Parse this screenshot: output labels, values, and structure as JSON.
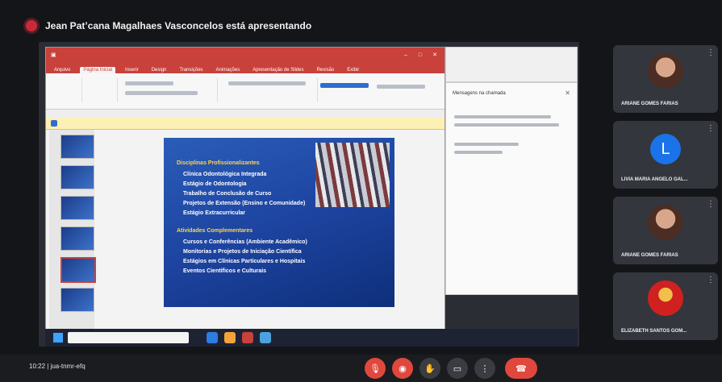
{
  "meeting": {
    "presenter_banner": "Jean Pat’cana Magalhaes Vasconcelos está apresentando",
    "clock": "10:22 | jua-tnmr-efq"
  },
  "ppt": {
    "window_title": "",
    "tabs": [
      "Arquivo",
      "Página Inicial",
      "Inserir",
      "Design",
      "Transições",
      "Animações",
      "Apresentação de Slides",
      "Revisão",
      "Exibir"
    ],
    "active_tab_index": 1
  },
  "slide": {
    "lines": [
      "Disciplinas Profissionalizantes",
      "Clínica Odontológica Integrada",
      "Estágio de Odontologia",
      "Trabalho de Conclusão de Curso",
      "Projetos de Extensão (Ensino e Comunidade)",
      "Estágio Extracurricular",
      "",
      "Atividades Complementares",
      "Cursos e Conferências (Ambiente Acadêmico)",
      "Monitorias e Projetos de Iniciação Científica",
      "Estágios em Clínicas Particulares e Hospitais",
      "Eventos Científicos e Culturais"
    ]
  },
  "chat": {
    "title": "Mensagens na chamada"
  },
  "participants": [
    {
      "name": "ARIANE GOMES FARIAS",
      "type": "photo"
    },
    {
      "name": "LIVIA MARIA ANGELO GAL...",
      "type": "initial",
      "initial": "L"
    },
    {
      "name": "ARIANE GOMES FARIAS",
      "type": "photo"
    },
    {
      "name": "ELIZABETH SANTOS GOM...",
      "type": "photo-red"
    }
  ],
  "controls": [
    "mic-off",
    "cam-off",
    "raise-hand",
    "present",
    "more",
    "end-call"
  ]
}
